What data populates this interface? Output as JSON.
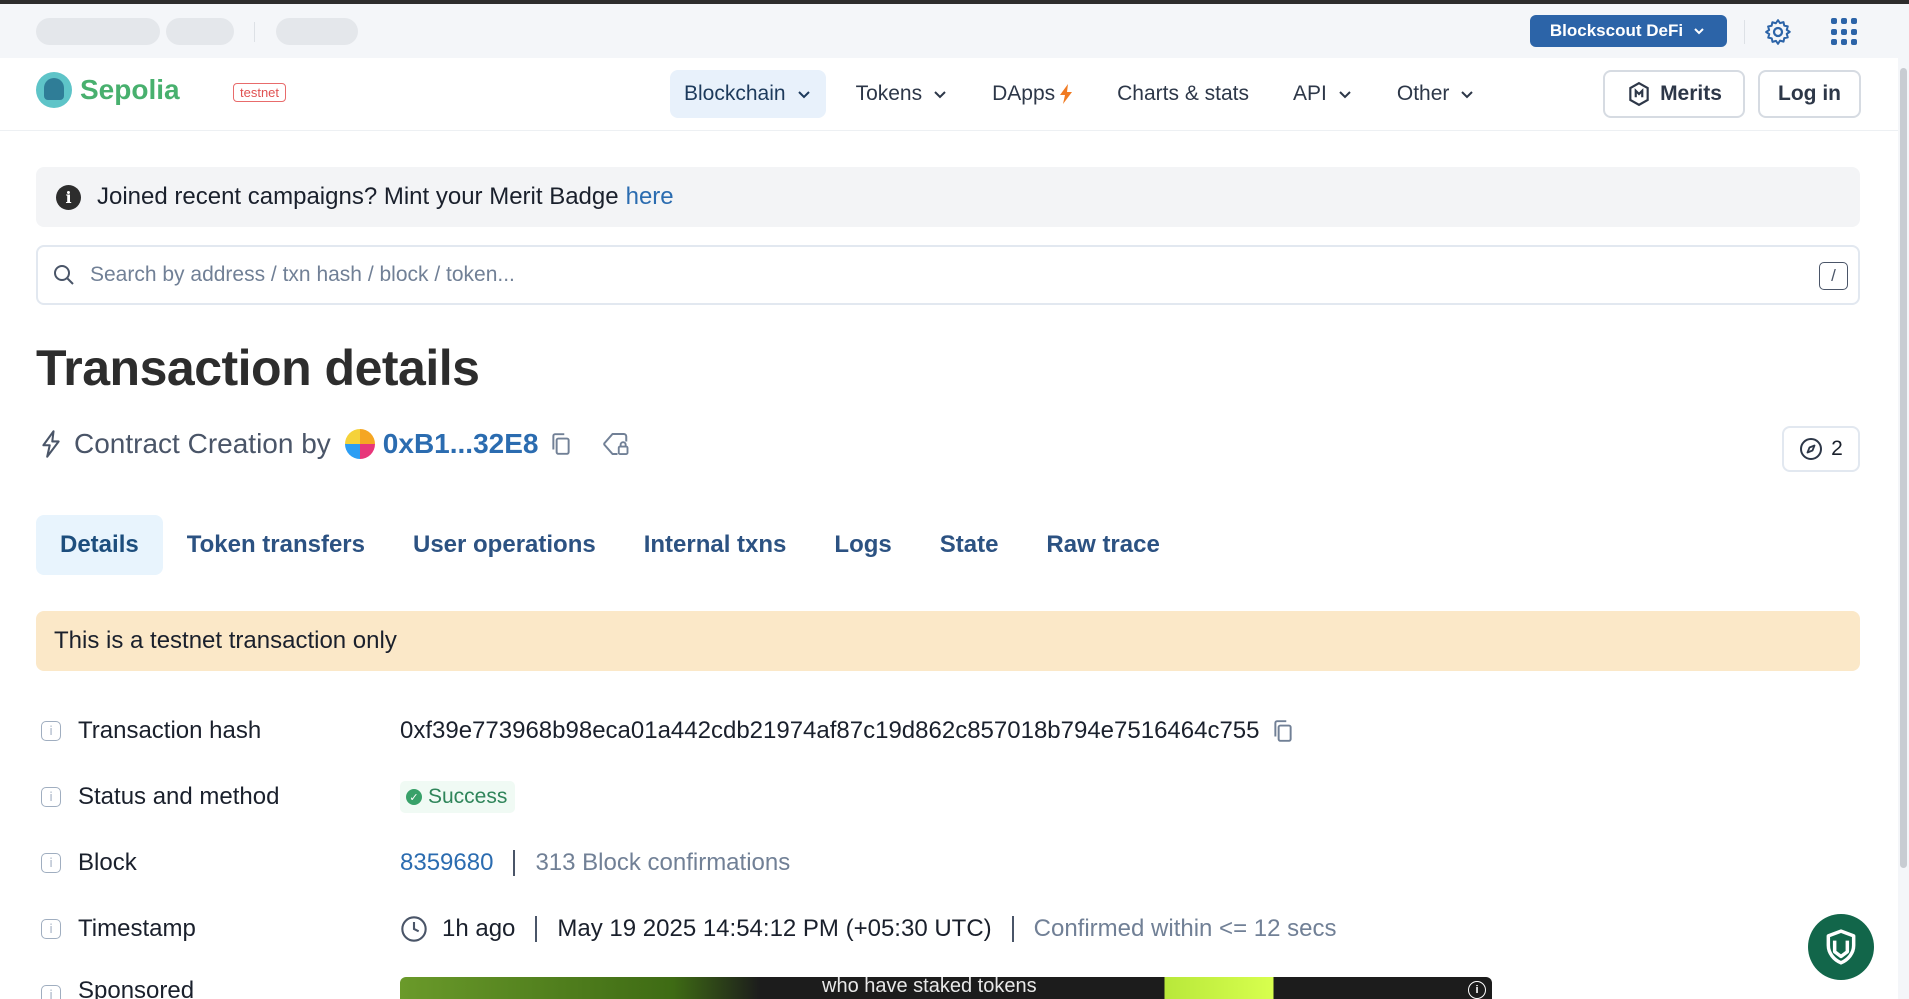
{
  "topbar": {
    "defi_label": "Blockscout DeFi"
  },
  "header": {
    "logo_text": "Sepolia",
    "network_tag": "testnet",
    "nav": [
      {
        "label": "Blockchain",
        "active": true
      },
      {
        "label": "Tokens"
      },
      {
        "label": "DApps"
      },
      {
        "label": "Charts & stats"
      },
      {
        "label": "API"
      },
      {
        "label": "Other"
      }
    ],
    "merits_label": "Merits",
    "login_label": "Log in"
  },
  "alert": {
    "text": "Joined recent campaigns? Mint your Merit Badge",
    "link": "here"
  },
  "search": {
    "placeholder": "Search by address / txn hash / block / token...",
    "shortcut": "/"
  },
  "page": {
    "title": "Transaction details",
    "creation_prefix": "Contract Creation by",
    "creator_address": "0xB1...32E8",
    "view_count": "2"
  },
  "tabs": [
    {
      "label": "Details",
      "active": true
    },
    {
      "label": "Token transfers"
    },
    {
      "label": "User operations"
    },
    {
      "label": "Internal txns"
    },
    {
      "label": "Logs"
    },
    {
      "label": "State"
    },
    {
      "label": "Raw trace"
    }
  ],
  "warning": "This is a testnet transaction only",
  "details": {
    "hash_label": "Transaction hash",
    "hash_value": "0xf39e773968b98eca01a442cdb21974af87c19d862c857018b794e7516464c755",
    "status_label": "Status and method",
    "status_value": "Success",
    "block_label": "Block",
    "block_value": "8359680",
    "block_confirmations": "313 Block confirmations",
    "timestamp_label": "Timestamp",
    "timestamp_relative": "1h ago",
    "timestamp_absolute": "May 19 2025 14:54:12 PM (+05:30 UTC)",
    "timestamp_confirmed": "Confirmed within <= 12 secs",
    "sponsored_label": "Sponsored",
    "ad_text": "who have staked tokens"
  },
  "colors": {
    "accent": "#2b6cb0",
    "brand_green": "#48b06e",
    "success": "#38a169",
    "warning_bg": "#fbe8c8"
  }
}
